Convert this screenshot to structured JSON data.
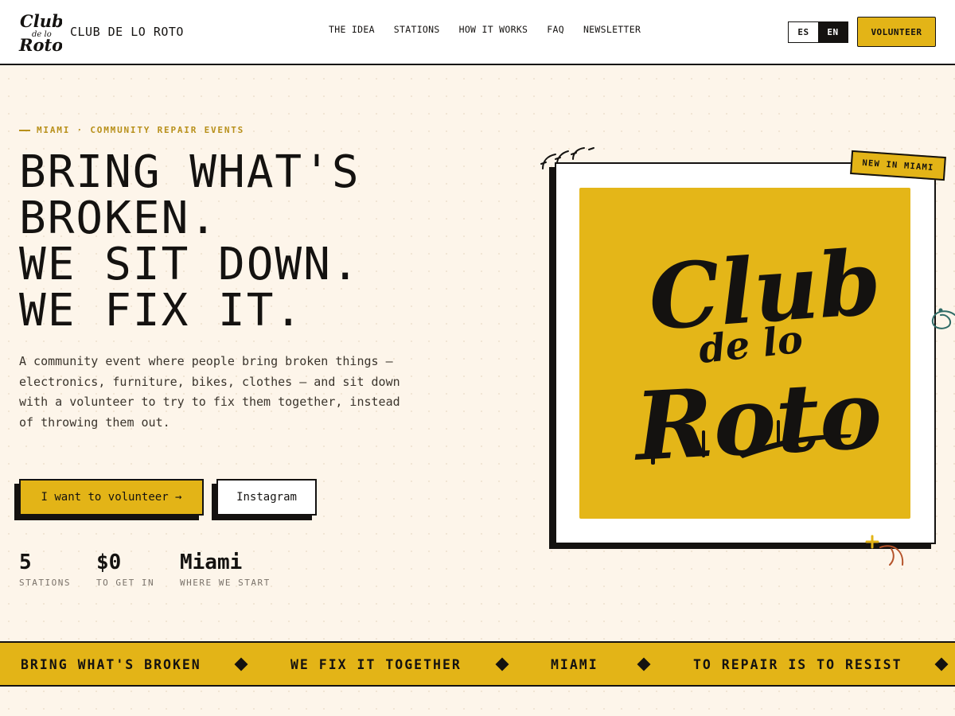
{
  "header": {
    "logo_text": "Club de lo Roto",
    "brand": "CLUB DE LO ROTO",
    "nav": [
      "THE IDEA",
      "STATIONS",
      "HOW IT WORKS",
      "FAQ",
      "NEWSLETTER"
    ],
    "lang": {
      "es": "ES",
      "en": "EN",
      "selected": "EN"
    },
    "volunteer_label": "VOLUNTEER"
  },
  "hero": {
    "eyebrow": "MIAMI · COMMUNITY REPAIR EVENTS",
    "headline": [
      "BRING WHAT'S",
      "BROKEN.",
      "WE SIT DOWN.",
      "WE FIX IT."
    ],
    "lead": "A community event where people bring broken things — electronics, furniture, bikes, clothes — and sit down with a volunteer to try to fix them together, instead of throwing them out.",
    "primary_button": "I want to volunteer →",
    "secondary_button": "Instagram",
    "stats": [
      {
        "value": "5",
        "label": "STATIONS"
      },
      {
        "value": "$0",
        "label": "TO GET IN"
      },
      {
        "value": "Miami",
        "label": "WHERE WE START"
      }
    ]
  },
  "card": {
    "badge": "NEW IN MIAMI",
    "poster_text": "Club de lo Roto"
  },
  "marquee": [
    "BRING WHAT'S BROKEN",
    "WE FIX IT TOGETHER",
    "MIAMI",
    "TO REPAIR IS TO RESIST"
  ],
  "colors": {
    "accent": "#e3b417",
    "ink": "#141210",
    "background": "#fdf5ea",
    "eyebrow": "#b8901a",
    "doodle_teal": "#2f6b66",
    "doodle_rust": "#b5532a"
  }
}
